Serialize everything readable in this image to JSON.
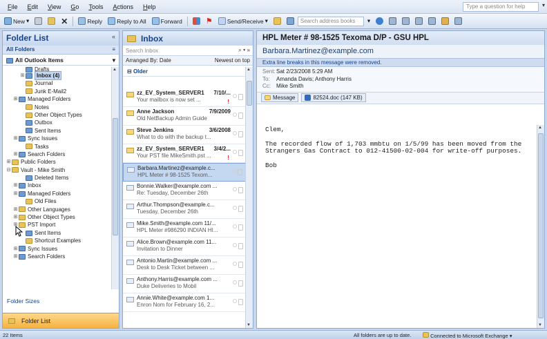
{
  "menu": {
    "items": [
      {
        "u": "F",
        "rest": "ile"
      },
      {
        "u": "E",
        "rest": "dit"
      },
      {
        "u": "V",
        "rest": "iew"
      },
      {
        "u": "G",
        "rest": "o"
      },
      {
        "u": "T",
        "rest": "ools"
      },
      {
        "u": "A",
        "rest": "ctions"
      },
      {
        "u": "H",
        "rest": "elp"
      }
    ],
    "help_placeholder": "Type a question for help"
  },
  "toolbar": {
    "new": "New",
    "reply": "Reply",
    "reply_all": "Reply to All",
    "forward": "Forward",
    "send_receive": "Send/Receive",
    "search_address": "Search address books"
  },
  "folder_pane": {
    "title": "Folder List",
    "all_folders": "All Folders",
    "tree_root": "All Outlook Items",
    "folder_sizes": "Folder Sizes",
    "footer_button": "Folder List",
    "tree": [
      {
        "indent": 2,
        "exp": "",
        "label": "Drafts",
        "color": "b",
        "partial": true
      },
      {
        "indent": 2,
        "exp": "⊞",
        "label": "Inbox (4)",
        "color": "b",
        "selected": true
      },
      {
        "indent": 2,
        "exp": "",
        "label": "Journal",
        "color": "y"
      },
      {
        "indent": 2,
        "exp": "",
        "label": "Junk E-Mail2",
        "color": "y"
      },
      {
        "indent": 1,
        "exp": "⊞",
        "label": "Managed Folders",
        "color": "b"
      },
      {
        "indent": 2,
        "exp": "",
        "label": "Notes",
        "color": "y"
      },
      {
        "indent": 2,
        "exp": "",
        "label": "Other Object Types",
        "color": "y"
      },
      {
        "indent": 2,
        "exp": "",
        "label": "Outbox",
        "color": "b"
      },
      {
        "indent": 2,
        "exp": "",
        "label": "Sent Items",
        "color": "b"
      },
      {
        "indent": 1,
        "exp": "⊞",
        "label": "Sync Issues",
        "color": "b"
      },
      {
        "indent": 2,
        "exp": "",
        "label": "Tasks",
        "color": "y"
      },
      {
        "indent": 1,
        "exp": "⊞",
        "label": "Search Folders",
        "color": "b"
      },
      {
        "indent": 0,
        "exp": "⊞",
        "label": "Public Folders",
        "color": "y"
      },
      {
        "indent": 0,
        "exp": "⊟",
        "label": "Vault - Mike Smith",
        "color": "y"
      },
      {
        "indent": 2,
        "exp": "",
        "label": "Deleted Items",
        "color": "b"
      },
      {
        "indent": 1,
        "exp": "⊞",
        "label": "Inbox",
        "color": "b"
      },
      {
        "indent": 1,
        "exp": "⊞",
        "label": "Managed Folders",
        "color": "b"
      },
      {
        "indent": 2,
        "exp": "",
        "label": "Old Files",
        "color": "y"
      },
      {
        "indent": 1,
        "exp": "⊞",
        "label": "Other Languages",
        "color": "y"
      },
      {
        "indent": 1,
        "exp": "⊞",
        "label": "Other Object Types",
        "color": "y"
      },
      {
        "indent": 1,
        "exp": "⊞",
        "label": "PST Import",
        "color": "y"
      },
      {
        "indent": 2,
        "exp": "",
        "label": "Sent Items",
        "color": "b"
      },
      {
        "indent": 2,
        "exp": "",
        "label": "Shortcut Examples",
        "color": "y"
      },
      {
        "indent": 1,
        "exp": "⊞",
        "label": "Sync Issues",
        "color": "b"
      },
      {
        "indent": 1,
        "exp": "⊞",
        "label": "Search Folders",
        "color": "b"
      }
    ]
  },
  "list_pane": {
    "title": "Inbox",
    "search_placeholder": "Search Inbox",
    "arranged_by": "Arranged By: Date",
    "sort_order": "Newest on top",
    "group": "Older",
    "messages": [
      {
        "from": "zz_EV_System_SERVER1",
        "date": "7/10/...",
        "subject": "Your mailbox is now set ...",
        "unread": true,
        "important": "!"
      },
      {
        "from": "Anne Jackson",
        "date": "7/9/2009",
        "subject": "Old NetBackup Admin Guide",
        "unread": true,
        "important": ""
      },
      {
        "from": "Steve Jenkins",
        "date": "3/6/2008",
        "subject": "What to do with the backup t...",
        "unread": true,
        "important": ""
      },
      {
        "from": "zz_EV_System_SERVER1",
        "date": "3/4/2...",
        "subject": "Your PST file MikeSmith.pst ...",
        "unread": true,
        "important": "!"
      },
      {
        "from": "Barbara.Martinez@example.c...",
        "date": "",
        "subject": "HPL Meter # 98-1525 Texom...",
        "unread": false,
        "selected": true,
        "important": ""
      },
      {
        "from": "Bonnie.Walker@example.com ...",
        "date": "",
        "subject": "Re: Tuesday, December 26th",
        "unread": false,
        "important": ""
      },
      {
        "from": "Arthur.Thompson@example.c...",
        "date": "",
        "subject": "Tuesday, December 26th",
        "unread": false,
        "important": ""
      },
      {
        "from": "Mike.Smith@example.com 11/...",
        "date": "",
        "subject": "HPL Meter #986290 INDIAN HI...",
        "unread": false,
        "important": ""
      },
      {
        "from": "Alice.Brown@example.com 11...",
        "date": "",
        "subject": "Invitation to Dinner",
        "unread": false,
        "important": ""
      },
      {
        "from": "Antonio.Martin@example.com ...",
        "date": "",
        "subject": "Desk to Desk Ticket between ...",
        "unread": false,
        "important": ""
      },
      {
        "from": "Anthony.Harris@example.com ...",
        "date": "",
        "subject": "Duke Deliveries to Mobil",
        "unread": false,
        "important": ""
      },
      {
        "from": "Annie.White@example.com 1...",
        "date": "",
        "subject": "Enron Nom for February 16, 2...",
        "unread": false,
        "important": ""
      }
    ]
  },
  "reading_pane": {
    "subject": "HPL Meter # 98-1525 Texoma D/P - GSU HPL",
    "from": "Barbara.Martinez@example.com",
    "infobar": "Extra line breaks in this message were removed.",
    "sent_label": "Sent:",
    "sent": "Sat 2/23/2008 5:29 AM",
    "to_label": "To:",
    "to": "Amanda Davis; Anthony Harris",
    "cc_label": "Cc:",
    "cc": "Mike Smith",
    "message_tab": "Message",
    "attachment": "82524.doc (147 KB)",
    "body": [
      "Clem,",
      "The recorded flow of 1,703 mmbtu on 1/5/99 has been moved from the Strangers Gas Contract to 012-41500-02-004 for write-off purposes.",
      "Bob"
    ]
  },
  "status": {
    "items": "22 Items",
    "sync": "All folders are up to date.",
    "connection": "Connected to Microsoft Exchange"
  },
  "colors": {
    "accent": "#15428b",
    "pane_border": "#8fa9cf",
    "footer_button": "#f5b242"
  }
}
